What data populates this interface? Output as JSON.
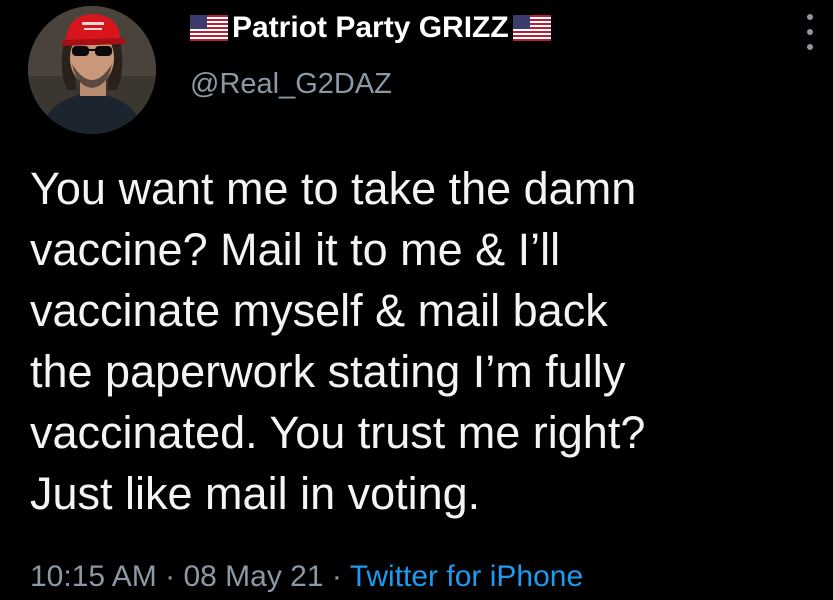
{
  "user": {
    "display_name": "Patriot Party GRIZZ",
    "handle": "@Real_G2DAZ",
    "avatar_icon": "profile-photo-red-cap",
    "flag_icon": "us-flag-icon"
  },
  "tweet": {
    "lines": [
      "You want me to take the damn",
      "vaccine? Mail it to me & I’ll",
      "vaccinate myself & mail back",
      "the paperwork stating I’m fully",
      "vaccinated. You trust me right?",
      "Just like mail in voting."
    ]
  },
  "meta": {
    "time": "10:15 AM",
    "separator": "·",
    "date": "08 May 21",
    "source": "Twitter for iPhone"
  },
  "colors": {
    "background": "#000000",
    "text": "#f2f4f5",
    "secondary": "#8b98a5",
    "link": "#1d9bf0"
  }
}
